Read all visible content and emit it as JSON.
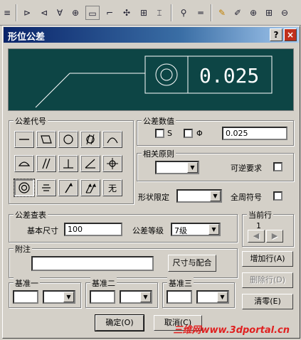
{
  "dialog": {
    "title": "形位公差",
    "help_glyph": "?",
    "close_glyph": "×"
  },
  "preview": {
    "value": "0.025"
  },
  "symbols": {
    "label": "公差代号",
    "items": [
      "straightness",
      "flatness",
      "circularity",
      "cylindricity",
      "profile-of-line",
      "profile-of-surface",
      "parallelism",
      "perpendicularity",
      "angularity",
      "position",
      "concentricity",
      "symmetry",
      "circular-runout",
      "total-runout",
      "none"
    ],
    "none_glyph": "无"
  },
  "tolerance": {
    "label": "公差数值",
    "s_label": "S",
    "phi_label": "Φ",
    "value": "0.025"
  },
  "principle": {
    "label": "相关原则",
    "selected": "",
    "reversible_label": "可逆要求"
  },
  "shape_limit": {
    "label": "形状限定",
    "selected": ""
  },
  "all_around": {
    "label": "全周符号"
  },
  "lookup": {
    "label": "公差查表",
    "base_size_label": "基本尺寸",
    "base_size": "100",
    "grade_label": "公差等级",
    "grade": "7级"
  },
  "current_row": {
    "label": "当前行",
    "value": "1"
  },
  "note": {
    "label": "附注",
    "value": "",
    "size_fit_button": "尺寸与配合"
  },
  "datums": [
    {
      "label": "基准一",
      "value": "",
      "modifier": ""
    },
    {
      "label": "基准二",
      "value": "",
      "modifier": ""
    },
    {
      "label": "基准三",
      "value": "",
      "modifier": ""
    }
  ],
  "row_buttons": {
    "add": "增加行(A)",
    "delete": "删除行(D)",
    "clear": "清零(E)"
  },
  "footer": {
    "ok": "确定(O)",
    "cancel": "取消(C)"
  },
  "watermark": "三维网www.3dportal.cn",
  "colors": {
    "title_start": "#0a246a",
    "preview_bg": "#0d4545",
    "preview_ink": "#ffffff",
    "watermark": "#e02020"
  }
}
